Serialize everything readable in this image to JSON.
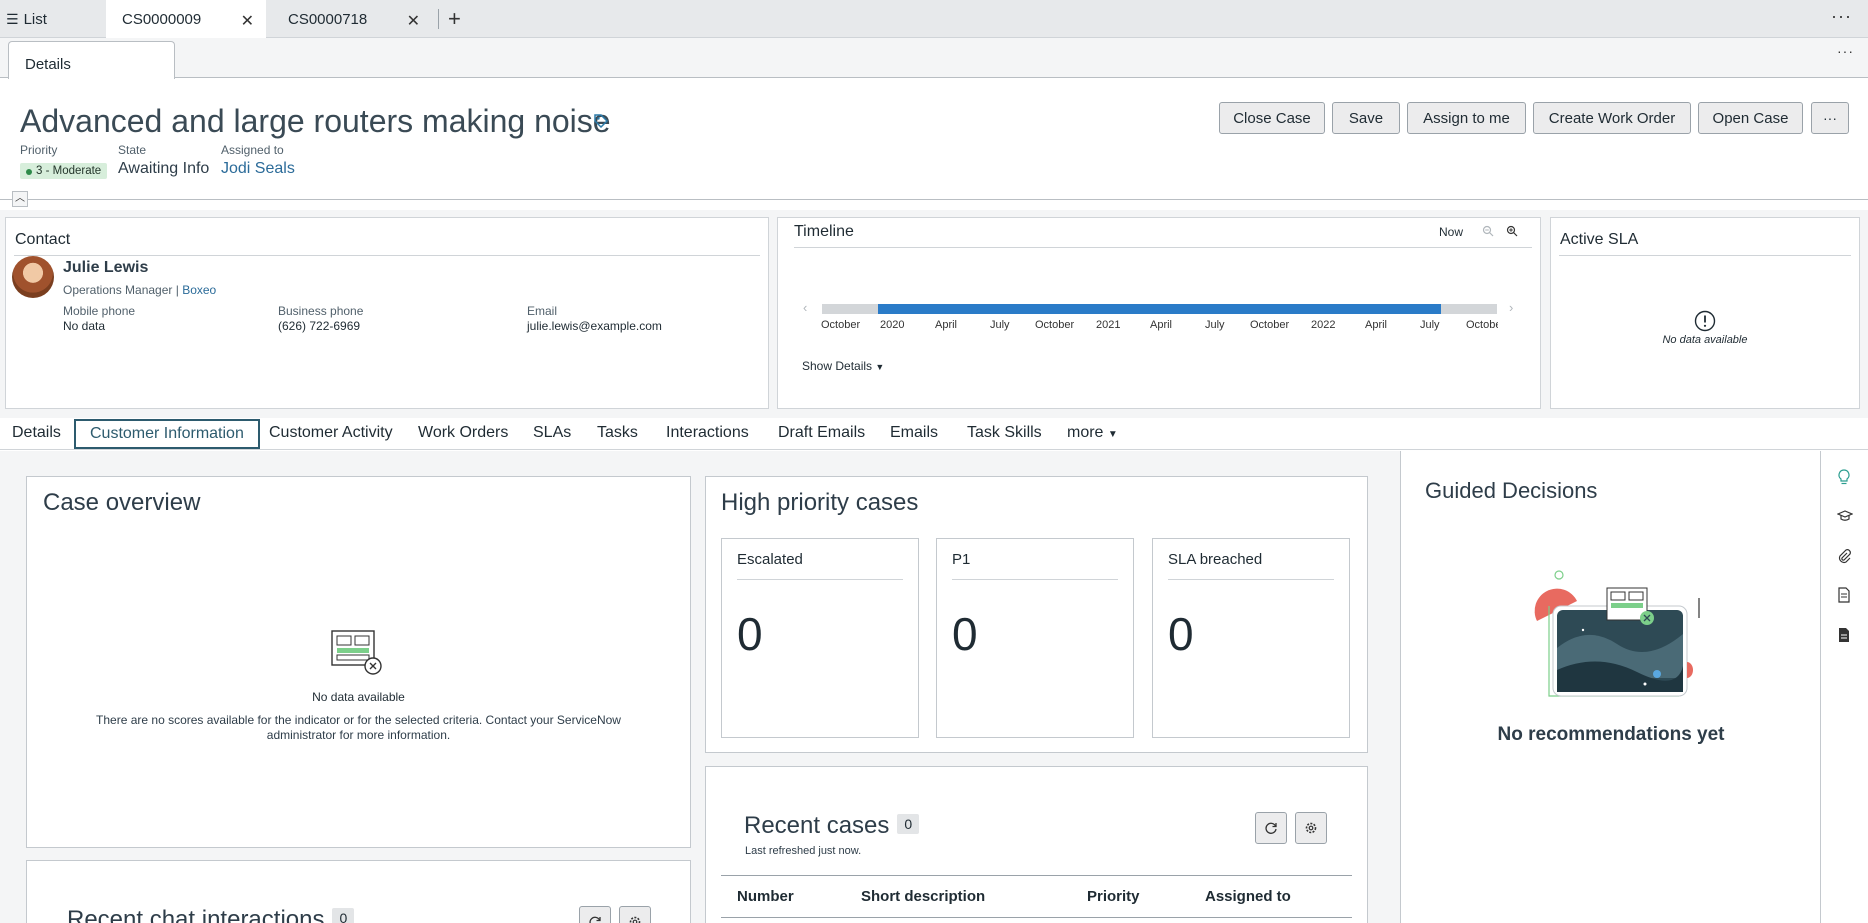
{
  "tabs": {
    "list_label": "List",
    "items": [
      {
        "label": "CS0000009"
      },
      {
        "label": "CS0000718"
      }
    ]
  },
  "subtab": {
    "label": "Details"
  },
  "record": {
    "title": "Advanced and large routers making noise",
    "priority_label": "Priority",
    "priority_value": "3 - Moderate",
    "priority_color": "#2e8b4a",
    "state_label": "State",
    "state_value": "Awaiting Info",
    "assigned_label": "Assigned to",
    "assigned_value": "Jodi Seals"
  },
  "actions": {
    "close_case": "Close Case",
    "save": "Save",
    "assign_to_me": "Assign to me",
    "create_work_order": "Create Work Order",
    "open_case": "Open Case"
  },
  "contact": {
    "title": "Contact",
    "name": "Julie Lewis",
    "role": "Operations Manager",
    "company": "Boxeo",
    "mobile_label": "Mobile phone",
    "mobile_value": "No data",
    "business_label": "Business phone",
    "business_value": "(626) 722-6969",
    "email_label": "Email",
    "email_value": "julie.lewis@example.com"
  },
  "timeline": {
    "title": "Timeline",
    "now_label": "Now",
    "ticks": [
      "October",
      "2020",
      "April",
      "July",
      "October",
      "2021",
      "April",
      "July",
      "October",
      "2022",
      "April",
      "July",
      "Octobe"
    ],
    "show_details": "Show Details",
    "accent": "#2a7bc8"
  },
  "sla": {
    "title": "Active SLA",
    "empty": "No data available"
  },
  "navtabs": [
    "Details",
    "Customer Information",
    "Customer Activity",
    "Work Orders",
    "SLAs",
    "Tasks",
    "Interactions",
    "Draft Emails",
    "Emails",
    "Task Skills",
    "more"
  ],
  "overview": {
    "title": "Case overview",
    "empty_title": "No data available",
    "empty_text": "There are no scores available for the indicator or for the selected criteria. Contact your ServiceNow administrator for more information."
  },
  "chat": {
    "title": "Recent chat interactions",
    "count": "0"
  },
  "high_priority": {
    "title": "High priority cases",
    "metrics": [
      {
        "label": "Escalated",
        "value": "0"
      },
      {
        "label": "P1",
        "value": "0"
      },
      {
        "label": "SLA breached",
        "value": "0"
      }
    ]
  },
  "recent": {
    "title": "Recent cases",
    "count": "0",
    "refreshed": "Last refreshed just now.",
    "columns": [
      "Number",
      "Short description",
      "Priority",
      "Assigned to"
    ]
  },
  "guided": {
    "title": "Guided Decisions",
    "empty": "No recommendations yet"
  },
  "side_icons": [
    "lightbulb-icon",
    "graduation-cap-icon",
    "paperclip-icon",
    "document-icon",
    "file-icon"
  ]
}
